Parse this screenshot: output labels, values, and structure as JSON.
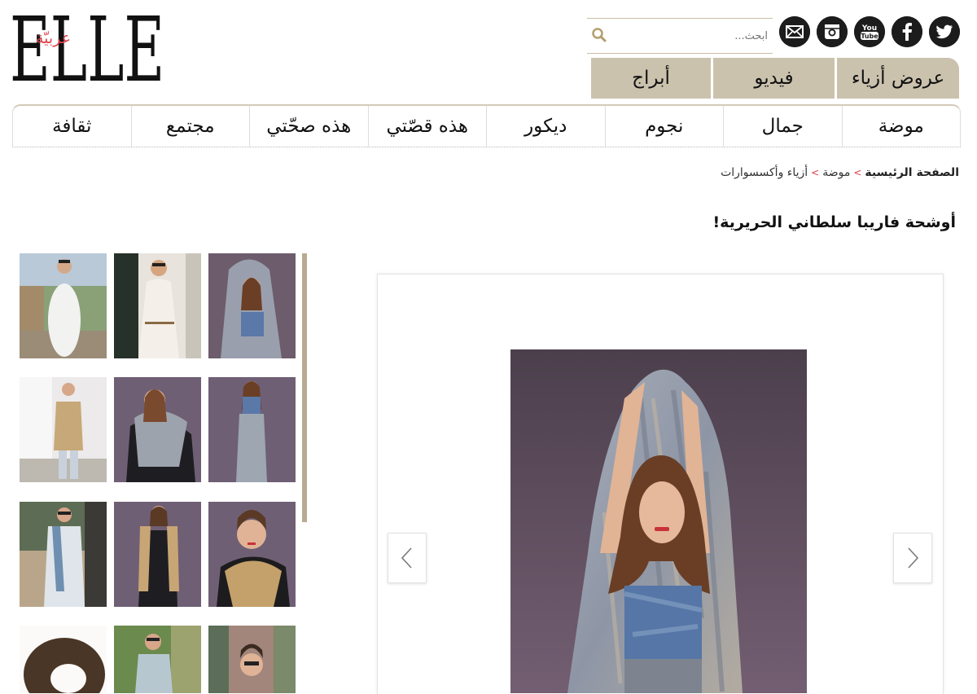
{
  "logo": {
    "big": "ELLE",
    "sub": "عربيّة"
  },
  "search": {
    "placeholder": "ابحث..."
  },
  "social": [
    "twitter-icon",
    "facebook-icon",
    "youtube-icon",
    "instagram-icon",
    "mail-icon"
  ],
  "social_text": {
    "youtube_top": "You",
    "youtube_bottom": "Tube"
  },
  "top_tabs": [
    "عروض أزياء",
    "فيديو",
    "أبراج"
  ],
  "nav": [
    "موضة",
    "جمال",
    "نجوم",
    "ديكور",
    "هذه قصّتي",
    "هذه صحّتي",
    "مجتمع",
    "ثقافة"
  ],
  "breadcrumb": {
    "home": "الصفحة الرئيسية",
    "sep": ">",
    "level1": "موضة",
    "level2": "أزياء وأكسسوارات"
  },
  "article": {
    "title": "أوشحة فاريبا سلطاني الحريرية!"
  },
  "colors": {
    "tab_bg": "#cbc2ae",
    "accent_red": "#d9414a",
    "scroll": "#b8ab90"
  }
}
